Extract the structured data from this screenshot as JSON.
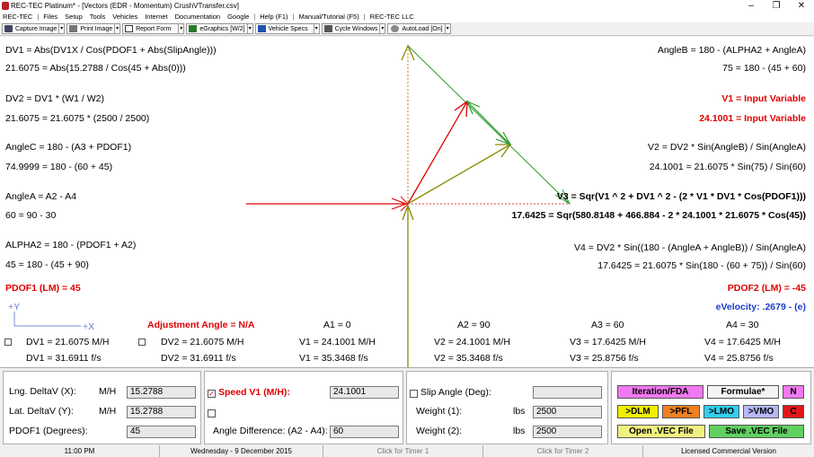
{
  "window": {
    "title": "REC-TEC Platinum* - [Vectors (EDR - Momentum)  CrushVTransfer.csv]",
    "minimize": "–",
    "maximize": "❐",
    "close": "✕"
  },
  "menu": [
    "REC-TEC",
    "Files",
    "Setup",
    "Tools",
    "Vehicles",
    "Internet",
    "Documentation",
    "Google",
    "Help (F1)",
    "Manual/Tutorial (F5)",
    "REC-TEC LLC"
  ],
  "toolbar": {
    "capture": "Capture Image",
    "print": "Print Image",
    "report": "Report Form",
    "egraphics": "eGraphics [W/2]",
    "vehicle": "Vehicle Specs",
    "cycle": "Cycle Windows",
    "autoload": "AutoLoad [On]"
  },
  "eq": {
    "dv1_formula": "DV1 = Abs(DV1X / Cos(PDOF1 + Abs(SlipAngle)))",
    "dv1_calc": "21.6075 = Abs(15.2788 / Cos(45 + Abs(0)))",
    "dv2_formula": "DV2 = DV1 * (W1 / W2)",
    "dv2_calc": "21.6075 = 21.6075 * (2500 / 2500)",
    "anglec_formula": "AngleC = 180 - (A3 + PDOF1)",
    "anglec_calc": "74.9999 = 180 - (60 + 45)",
    "anglea_formula": "AngleA = A2 - A4",
    "anglea_calc": "60 = 90 - 30",
    "alpha2_formula": "ALPHA2 = 180 - (PDOF1 + A2)",
    "alpha2_calc": "45 = 180 - (45 + 90)",
    "pdof1": "PDOF1 (LM) = 45",
    "angleb_formula": "AngleB = 180 - (ALPHA2 + AngleA)",
    "angleb_calc": "75 = 180 - (45 + 60)",
    "v1_formula": "V1 = Input Variable",
    "v1_calc": "24.1001 = Input Variable",
    "v2_formula": "V2 = DV2 * Sin(AngleB) / Sin(AngleA)",
    "v2_calc": "24.1001 = 21.6075 * Sin(75) / Sin(60)",
    "v3_formula": "V3 = Sqr(V1 ^ 2 + DV1 ^ 2 - (2 * V1 * DV1 * Cos(PDOF1)))",
    "v3_calc": "17.6425 = Sqr(580.8148 + 466.884 - 2 * 24.1001 * 21.6075 * Cos(45))",
    "v4_formula": "V4 = DV2 * Sin((180 - (AngleA + AngleB)) / Sin(AngleA)",
    "v4_calc": "17.6425 = 21.6075 * Sin(180 - (60 + 75)) / Sin(60)",
    "pdof2": "PDOF2 (LM) = -45",
    "evelocity": "eVelocity:  .2679  -  (e)"
  },
  "axis": {
    "y": "+Y",
    "x": "+X"
  },
  "adjustment": "Adjustment Angle = N/A",
  "angles": {
    "a1": "A1 = 0",
    "a2": "A2 = 90",
    "a3": "A3 = 60",
    "a4": "A4 = 30"
  },
  "results": {
    "dv1_mh": "DV1 = 21.6075  M/H",
    "dv1_fs": "DV1 = 31.6911  f/s",
    "dv2_mh": "DV2 = 21.6075  M/H",
    "dv2_fs": "DV2 = 31.6911  f/s",
    "v1_mh": "V1 = 24.1001  M/H",
    "v1_fs": "V1 = 35.3468  f/s",
    "v2_mh": "V2 = 24.1001  M/H",
    "v2_fs": "V2 = 35.3468  f/s",
    "v3_mh": "V3 = 17.6425  M/H",
    "v3_fs": "V3 = 25.8756  f/s",
    "v4_mh": "V4 = 17.6425  M/H",
    "v4_fs": "V4 = 25.8756  f/s"
  },
  "inputs": {
    "lng_label": "Lng. DeltaV (X):",
    "lng_unit": "M/H",
    "lng_value": "15.2788",
    "lat_label": "Lat. DeltaV (Y):",
    "lat_unit": "M/H",
    "lat_value": "15.2788",
    "pdof1_label": "PDOF1 (Degrees):",
    "pdof1_value": "45",
    "speed_label": "Speed V1 (M/H):",
    "speed_value": "24.1001",
    "speed_check": "✓",
    "angle_diff_label": "Angle Difference: (A2 - A4):",
    "angle_diff_value": "60",
    "slip_label": "Slip Angle (Deg):",
    "slip_value": "",
    "w1_label": "Weight (1):",
    "w1_unit": "lbs",
    "w1_value": "2500",
    "w2_label": "Weight (2):",
    "w2_unit": "lbs",
    "w2_value": "2500"
  },
  "buttons": {
    "iteration": "Iteration/FDA",
    "formulae": "Formulae*",
    "n": "N",
    "dlm": ">DLM",
    "pfl": ">PFL",
    "lmo": ">LMO",
    "vmo": ">VMO",
    "c": "C",
    "open": "Open .VEC File",
    "save": "Save .VEC File"
  },
  "colors": {
    "red_vector": "#e00000",
    "olive_vector": "#8a8a00",
    "green_vector": "#2a9a2a",
    "label_red": "#e00000",
    "label_blue": "#1a3fcc"
  },
  "status": {
    "time": "11:00 PM",
    "date": "Wednesday  -  9 December 2015",
    "timer1": "Click for Timer 1",
    "timer2": "Click for Timer 2",
    "license": "Licensed Commercial Version"
  }
}
